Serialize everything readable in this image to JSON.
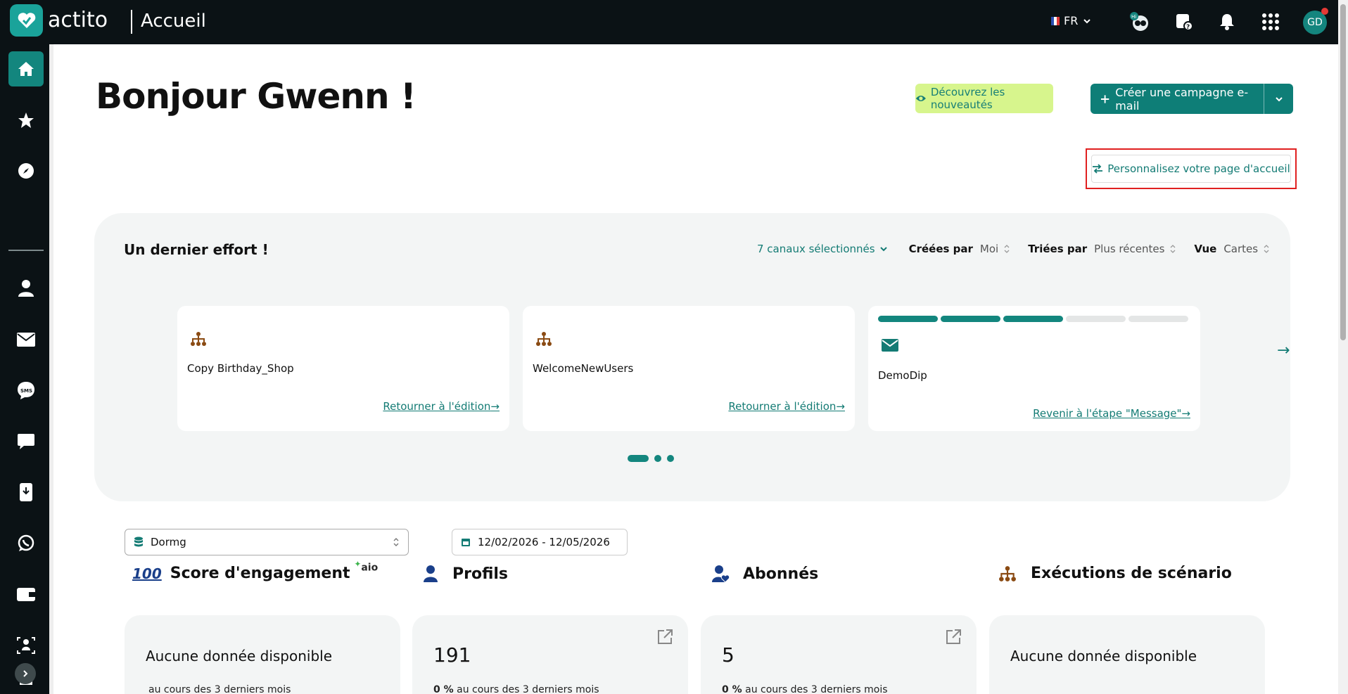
{
  "header": {
    "brand": "actito",
    "title": "Accueil",
    "lang": "FR",
    "avatar": "GD",
    "icons": [
      "flag-fr-icon",
      "chevron-down-icon",
      "mascot-icon",
      "help-chat-icon",
      "bell-icon",
      "apps-grid-icon"
    ]
  },
  "sidebar": {
    "items": [
      "home-icon",
      "star-icon",
      "compass-icon",
      "user-icon",
      "mail-icon",
      "sms-icon",
      "chat-icon",
      "mobile-push-icon",
      "whatsapp-icon",
      "wallet-icon",
      "team-icon",
      "document-icon"
    ]
  },
  "page": {
    "greeting": "Bonjour Gwenn !",
    "news_button": "Découvrez les nouveautés",
    "create_button": "Créer une campagne e-mail",
    "customize_button": "Personnalisez votre page d'accueil"
  },
  "panel": {
    "title": "Un dernier effort !",
    "channels": "7 canaux sélectionnés",
    "created_label": "Créées par",
    "created_value": "Moi",
    "sorted_label": "Triées par",
    "sorted_value": "Plus récentes",
    "view_label": "Vue",
    "view_value": "Cartes",
    "cards": [
      {
        "name": "Copy Birthday_Shop",
        "link": "Retourner à l'édition",
        "icon": "scenario-icon"
      },
      {
        "name": "WelcomeNewUsers",
        "link": "Retourner à l'édition",
        "icon": "scenario-icon"
      },
      {
        "name": "DemoDip",
        "link": "Revenir à l'étape \"Message\"",
        "icon": "envelope-icon",
        "progress_steps_done": 3,
        "progress_steps_total": 5
      }
    ],
    "carousel_pages": 3,
    "carousel_current": 1
  },
  "filters": {
    "database": "Dormg",
    "date_range": "12/02/2026 - 12/05/2026"
  },
  "kpis": [
    {
      "title": "Score d'engagement",
      "badge": "aio",
      "value": "Aucune donnée disponible",
      "sub": "au cours des 3 derniers mois",
      "icon": "hundred-icon"
    },
    {
      "title": "Profils",
      "value": "191",
      "sub_value": "0 %",
      "sub": "au cours des 3 derniers mois",
      "icon": "person-icon"
    },
    {
      "title": "Abonnés",
      "value": "5",
      "sub_value": "0 %",
      "sub": "au cours des 3 derniers mois",
      "icon": "subscriber-icon"
    },
    {
      "title": "Exécutions de scénario",
      "value": "Aucune donnée disponible",
      "icon": "scenario-icon"
    }
  ],
  "colors": {
    "brand": "#13867e",
    "topbar": "#0b1215",
    "news_bg": "#d7f58d",
    "highlight": "#e02020",
    "scenario_icon": "#8a4a12"
  }
}
